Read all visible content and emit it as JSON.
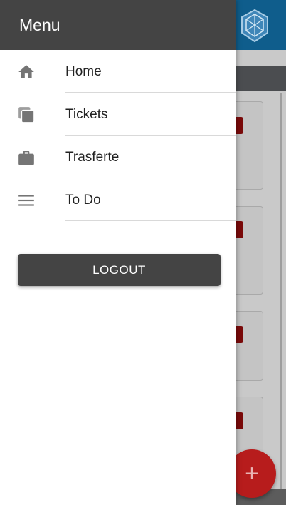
{
  "drawer": {
    "title": "Menu",
    "items": [
      {
        "label": "Home",
        "icon": "home-icon"
      },
      {
        "label": "Tickets",
        "icon": "copy-icon"
      },
      {
        "label": "Trasferte",
        "icon": "briefcase-icon"
      },
      {
        "label": "To Do",
        "icon": "list-icon"
      }
    ],
    "logout_label": "LOGOUT"
  },
  "fab": {
    "label": "+"
  },
  "colors": {
    "drawer_header": "#444444",
    "app_header": "#0f5d8c",
    "fab": "#b71c1c",
    "badge": "#7b0a0a"
  }
}
